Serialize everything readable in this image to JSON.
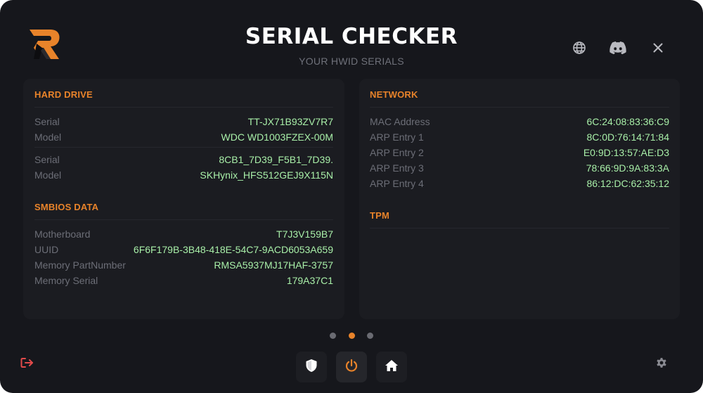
{
  "app": {
    "title": "SERIAL CHECKER",
    "subtitle": "YOUR HWID SERIALS",
    "logo_icon": "brand-r-logo"
  },
  "header_icons": {
    "language": "globe-icon",
    "discord": "discord-icon",
    "close": "close-icon"
  },
  "hard_drive": {
    "title": "HARD DRIVE",
    "drives": [
      {
        "serial_label": "Serial",
        "serial": "TT-JX71B93ZV7R7",
        "model_label": "Model",
        "model": "WDC WD1003FZEX-00M"
      },
      {
        "serial_label": "Serial",
        "serial": "8CB1_7D39_F5B1_7D39.",
        "model_label": "Model",
        "model": "SKHynix_HFS512GEJ9X115N"
      }
    ]
  },
  "smbios": {
    "title": "SMBIOS DATA",
    "rows": [
      {
        "label": "Motherboard",
        "value": "T7J3V159B7"
      },
      {
        "label": "UUID",
        "value": "6F6F179B-3B48-418E-54C7-9ACD6053A659"
      },
      {
        "label": "Memory PartNumber",
        "value": "RMSA5937MJ17HAF-3757"
      },
      {
        "label": "Memory Serial",
        "value": "179A37C1"
      }
    ]
  },
  "network": {
    "title": "NETWORK",
    "rows": [
      {
        "label": "MAC Address",
        "value": "6C:24:08:83:36:C9"
      },
      {
        "label": "ARP Entry 1",
        "value": "8C:0D:76:14:71:84"
      },
      {
        "label": "ARP Entry 2",
        "value": "E0:9D:13:57:AE:D3"
      },
      {
        "label": "ARP Entry 3",
        "value": "78:66:9D:9A:83:3A"
      },
      {
        "label": "ARP Entry 4",
        "value": "86:12:DC:62:35:12"
      }
    ]
  },
  "tpm": {
    "title": "TPM"
  },
  "pager": {
    "page_count": 3,
    "active_page": 2
  },
  "bottom_nav": {
    "buttons": [
      {
        "icon": "shield-icon"
      },
      {
        "icon": "power-icon",
        "active": true
      },
      {
        "icon": "home-icon"
      }
    ],
    "logout_icon": "logout-icon",
    "settings_icon": "gear-icon"
  },
  "colors": {
    "accent": "#e8832a",
    "value": "#a8efa8",
    "label": "#6c6e77",
    "background": "#16171c",
    "panel": "#1b1c21",
    "logout": "#e24a4a"
  }
}
